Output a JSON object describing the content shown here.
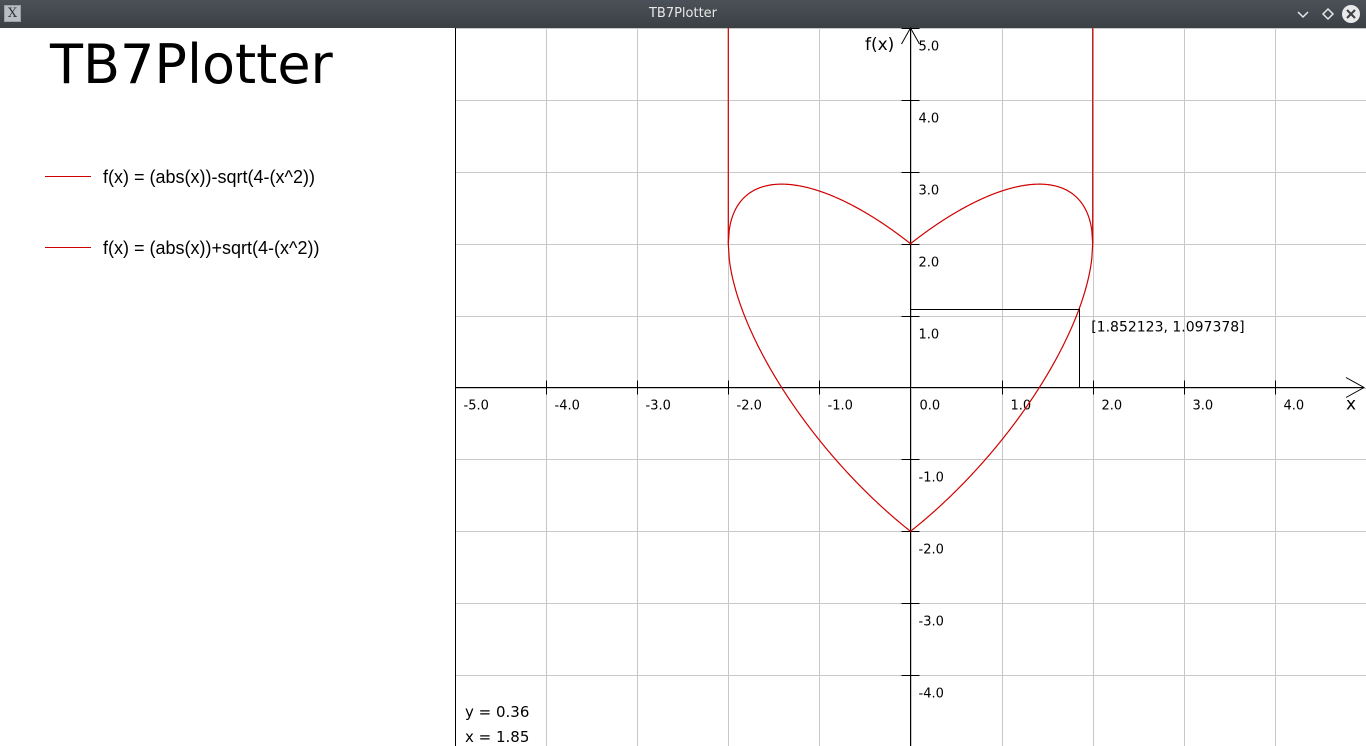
{
  "window": {
    "title": "TB7Plotter",
    "app_icon": "x-window-icon",
    "controls": [
      "minimize-icon",
      "maximize-icon",
      "close-icon"
    ]
  },
  "app": {
    "heading": "TB7Plotter"
  },
  "legend": [
    {
      "label": "f(x) = (abs(x))-sqrt(4-(x^2))",
      "color": "#d00000"
    },
    {
      "label": "f(x) = (abs(x))+sqrt(4-(x^2))",
      "color": "#d00000"
    }
  ],
  "chart_data": {
    "type": "line",
    "xlabel": "x",
    "ylabel": "f(x)",
    "xlim": [
      -5.0,
      5.0
    ],
    "ylim": [
      -5.0,
      5.0
    ],
    "grid": true,
    "x_ticks": [
      "-5.0",
      "-4.0",
      "-3.0",
      "-2.0",
      "-1.0",
      "0.0",
      "1.0",
      "2.0",
      "3.0",
      "4.0"
    ],
    "x_tick_values": [
      -5,
      -4,
      -3,
      -2,
      -1,
      0,
      1,
      2,
      3,
      4
    ],
    "y_ticks": [
      "5.0",
      "4.0",
      "3.0",
      "2.0",
      "1.0",
      "-1.0",
      "-2.0",
      "-3.0",
      "-4.0"
    ],
    "y_tick_values": [
      5,
      4,
      3,
      2,
      1,
      -1,
      -2,
      -3,
      -4
    ],
    "series": [
      {
        "name": "f(x) = (abs(x))-sqrt(4-(x^2))",
        "expression": "abs(x)-sqrt(4-x^2)",
        "domain": [
          -2,
          2
        ],
        "color": "#d00000"
      },
      {
        "name": "f(x) = (abs(x))+sqrt(4-(x^2))",
        "expression": "abs(x)+sqrt(4-x^2)",
        "domain": [
          -2,
          2
        ],
        "color": "#d00000"
      }
    ],
    "marker": {
      "x": 1.852123,
      "y": 1.097378,
      "label": "[1.852123, 1.097378]"
    }
  },
  "cursor": {
    "y_text": "y = 0.36",
    "x_text": "x = 1.85"
  }
}
